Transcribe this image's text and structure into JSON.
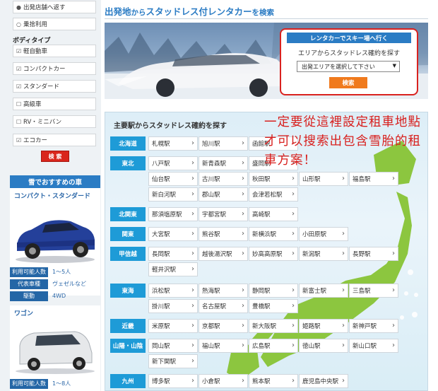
{
  "sidebar": {
    "options": [
      {
        "label": "出発店舗へ返す",
        "mark": "●"
      },
      {
        "label": "乗捨利用",
        "mark": "○"
      }
    ],
    "body_type_title": "ボディタイプ",
    "body_types": [
      {
        "label": "軽自動車",
        "mark": "☑"
      },
      {
        "label": "コンパクトカー",
        "mark": "☑"
      },
      {
        "label": "スタンダード",
        "mark": "☑"
      },
      {
        "label": "高級車",
        "mark": "☐"
      },
      {
        "label": "RV・ミニバン",
        "mark": "☐"
      },
      {
        "label": "エコカー",
        "mark": "☑"
      }
    ],
    "search_label": "検 索",
    "recommend": {
      "title": "雪でおすすめの車",
      "cars": [
        {
          "name": "コンパクト・スタンダード",
          "specs": [
            {
              "k": "利用可能人数",
              "v": "1〜5人"
            },
            {
              "k": "代表車種",
              "v": "ヴェゼルなど"
            },
            {
              "k": "駆動",
              "v": "4WD"
            }
          ]
        },
        {
          "name": "ワゴン",
          "specs": [
            {
              "k": "利用可能人数",
              "v": "1〜8人"
            }
          ]
        }
      ]
    }
  },
  "main": {
    "title_a": "出発地",
    "title_b": "から",
    "title_c": "スタッドレス付レンタカー",
    "title_d": "を検索",
    "widget": {
      "head": "レンタカーでスキー場へ行く",
      "label": "エリアからスタッドレス確約を探す",
      "select_value": "出発エリアを選択して下さい",
      "button": "検索"
    },
    "stations_title": "主要駅からスタッドレス確約を探す",
    "note": "一定要從這裡設定租車地點才可以搜索出包含雪胎的租車方案！",
    "regions": [
      {
        "name": "北海道",
        "rows": [
          [
            "札幌駅",
            "旭川駅",
            "函館駅"
          ]
        ]
      },
      {
        "name": "東北",
        "rows": [
          [
            "八戸駅",
            "新青森駅",
            "盛岡駅"
          ],
          [
            "仙台駅",
            "古川駅",
            "秋田駅",
            "山形駅",
            "福島駅"
          ],
          [
            "新白河駅",
            "郡山駅",
            "会津若松駅"
          ]
        ]
      },
      {
        "name": "北関東",
        "rows": [
          [
            "那須塩原駅",
            "宇都宮駅",
            "高崎駅"
          ]
        ]
      },
      {
        "name": "関東",
        "rows": [
          [
            "大宮駅",
            "熊谷駅",
            "新横浜駅",
            "小田原駅"
          ]
        ]
      },
      {
        "name": "甲信越",
        "rows": [
          [
            "長岡駅",
            "越後湯沢駅",
            "妙高高原駅",
            "新潟駅",
            "長野駅"
          ],
          [
            "軽井沢駅"
          ]
        ]
      },
      {
        "name": "東海",
        "rows": [
          [
            "浜松駅",
            "熱海駅",
            "静岡駅",
            "新富士駅",
            "三島駅"
          ],
          [
            "掛川駅",
            "名古屋駅",
            "豊橋駅"
          ]
        ]
      },
      {
        "name": "近畿",
        "rows": [
          [
            "米原駅",
            "京都駅",
            "新大阪駅",
            "姫路駅",
            "新神戸駅"
          ]
        ]
      },
      {
        "name": "山陽・山陰",
        "rows": [
          [
            "岡山駅",
            "福山駅",
            "広島駅",
            "徳山駅",
            "新山口駅"
          ],
          [
            "新下関駅"
          ]
        ]
      },
      {
        "name": "九州",
        "rows": [
          [
            "博多駅",
            "小倉駅",
            "熊本駅",
            "鹿児島中央駅"
          ]
        ]
      }
    ]
  },
  "colors": {
    "accent": "#2b7cc4",
    "region": "#1e9bd7",
    "note": "#d8201e",
    "button": "#d9261c",
    "widget_btn": "#f07a1d"
  }
}
